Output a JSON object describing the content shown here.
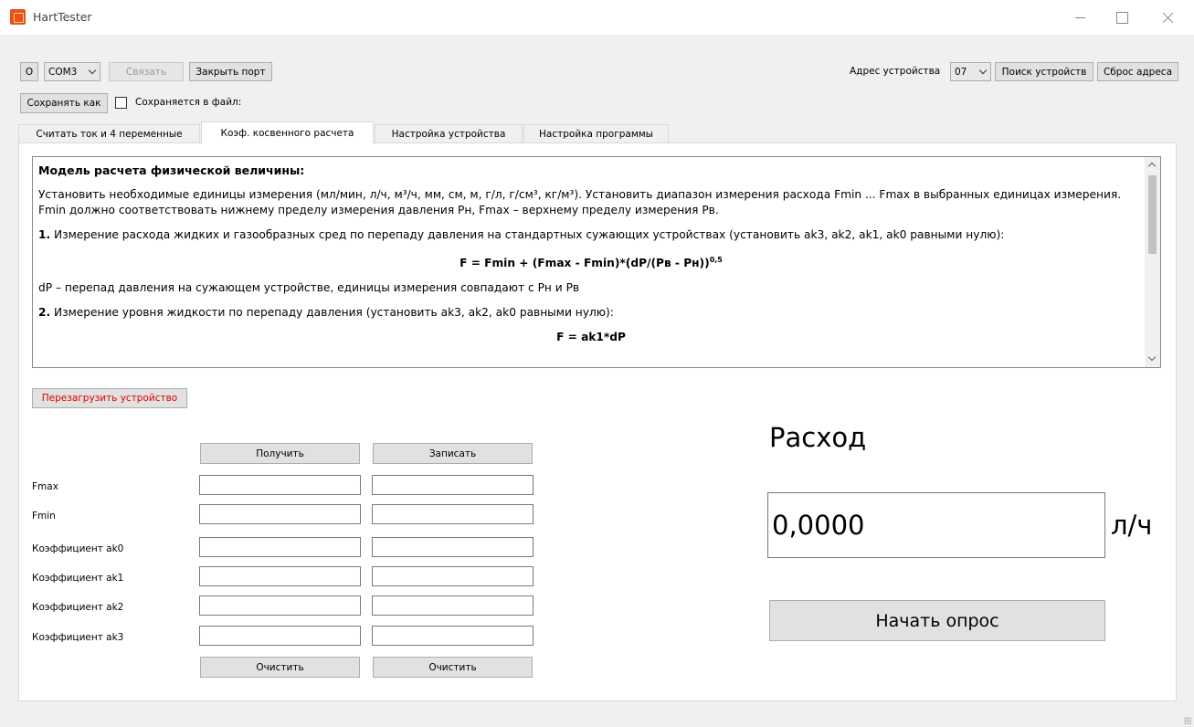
{
  "window": {
    "title": "HartTester"
  },
  "toolbar": {
    "o_label": "O",
    "port_value": "COM3",
    "connect_label": "Связать",
    "close_port_label": "Закрыть порт",
    "device_address_label": "Адрес устройства",
    "device_address_value": "07",
    "search_devices_label": "Поиск устройств",
    "reset_address_label": "Сброс адреса",
    "save_as_label": "Сохранять как",
    "save_to_file_label": "Сохраняется в файл:"
  },
  "tabs": [
    {
      "label": "Считать ток и 4 переменные",
      "active": false
    },
    {
      "label": "Коэф. косвенного расчета",
      "active": true
    },
    {
      "label": "Настройка устройства",
      "active": false
    },
    {
      "label": "Настройка программы",
      "active": false
    }
  ],
  "description": {
    "heading": "Модель расчета физической величины:",
    "para1": "Установить необходимые единицы измерения (мл/мин, л/ч, м³/ч, мм, см, м, г/л, г/см³, кг/м³). Установить диапазон измерения расхода Fmin ... Fmax в выбранных единицах измерения. Fmin должно соответствовать нижнему пределу измерения давления Pн, Fmax – верхнему пределу измерения Pв.",
    "item1_num": "1.",
    "item1_text": "Измерение расхода жидких и газообразных сред по перепаду давления на стандартных сужающих устройствах (установить ak3, ak2, ak1, ak0 равными нулю):",
    "formula1": "F = Fmin + (Fmax - Fmin)*(dP/(Pв - Pн))",
    "formula1_exp": "0,5",
    "dp_text": "dP – перепад давления на сужающем устройстве, единицы измерения совпадают с Pн и Pв",
    "item2_num": "2.",
    "item2_text": "Измерение уровня жидкости по перепаду давления (установить ak3, ak2, ak0 равными нулю):",
    "formula2": "F = ak1*dP"
  },
  "reboot_label": "Перезагрузить устройство",
  "coefficients": {
    "get_label": "Получить",
    "write_label": "Записать",
    "clear_label": "Очистить",
    "rows": [
      {
        "label": "Fmax",
        "read_value": "",
        "write_value": ""
      },
      {
        "label": "Fmin",
        "read_value": "",
        "write_value": ""
      },
      {
        "label": "Коэффициент ak0",
        "read_value": "",
        "write_value": ""
      },
      {
        "label": "Коэффициент ak1",
        "read_value": "",
        "write_value": ""
      },
      {
        "label": "Коэффициент ak2",
        "read_value": "",
        "write_value": ""
      },
      {
        "label": "Коэффициент ak3",
        "read_value": "",
        "write_value": ""
      }
    ]
  },
  "flow": {
    "title": "Расход",
    "value": "0,0000",
    "unit": "л/ч",
    "start_poll_label": "Начать опрос"
  }
}
